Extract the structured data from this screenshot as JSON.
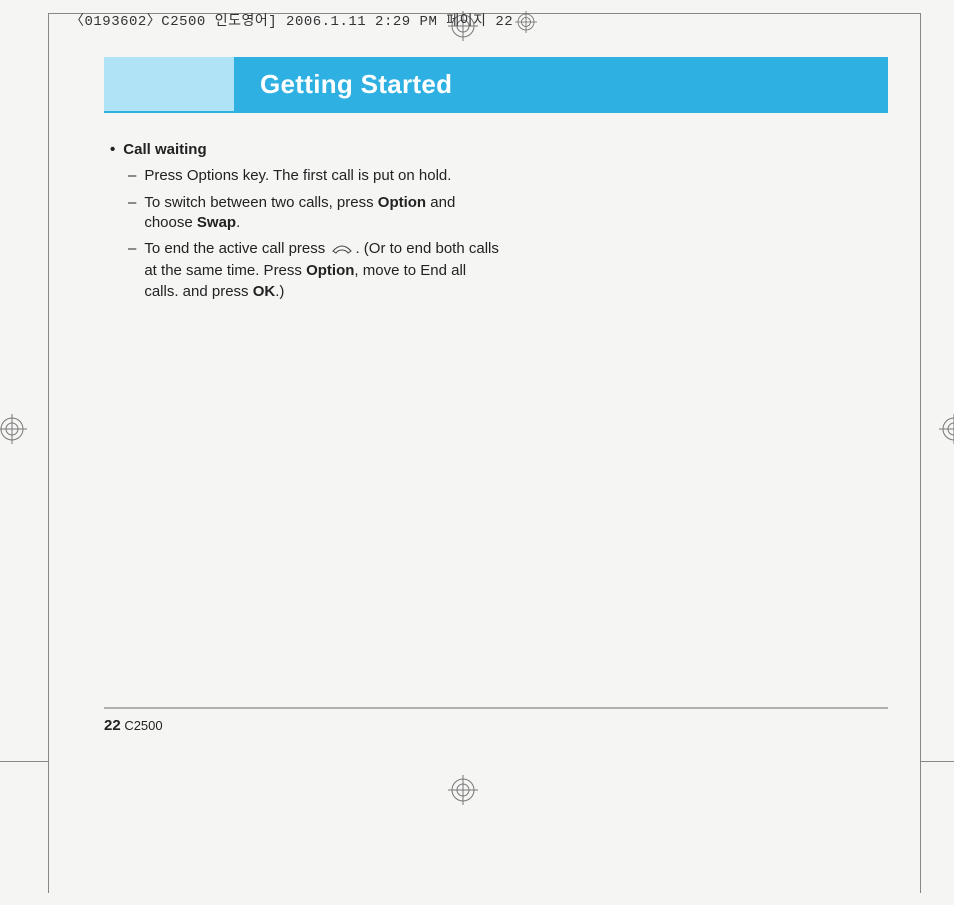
{
  "meta": {
    "header_line": "〈0193602〉C2500 인도영어]  2006.1.11 2:29 PM  페이지",
    "header_page": "22"
  },
  "title": "Getting Started",
  "bullet": {
    "heading": "Call waiting",
    "items": [
      {
        "pre": "Press Options key. The first call is put on hold."
      },
      {
        "pre": "To switch between two calls, press ",
        "b1": "Option",
        "mid": " and choose ",
        "b2": "Swap",
        "post": "."
      },
      {
        "pre": "To end the active call press ",
        "icon": "end-call-icon",
        "mid": ". (Or to end both calls at the same time. Press ",
        "b1": "Option",
        "mid2": ", move to End all calls. and press ",
        "b2": "OK",
        "post": ".)"
      }
    ]
  },
  "footer": {
    "page_number": "22",
    "model": "C2500"
  }
}
